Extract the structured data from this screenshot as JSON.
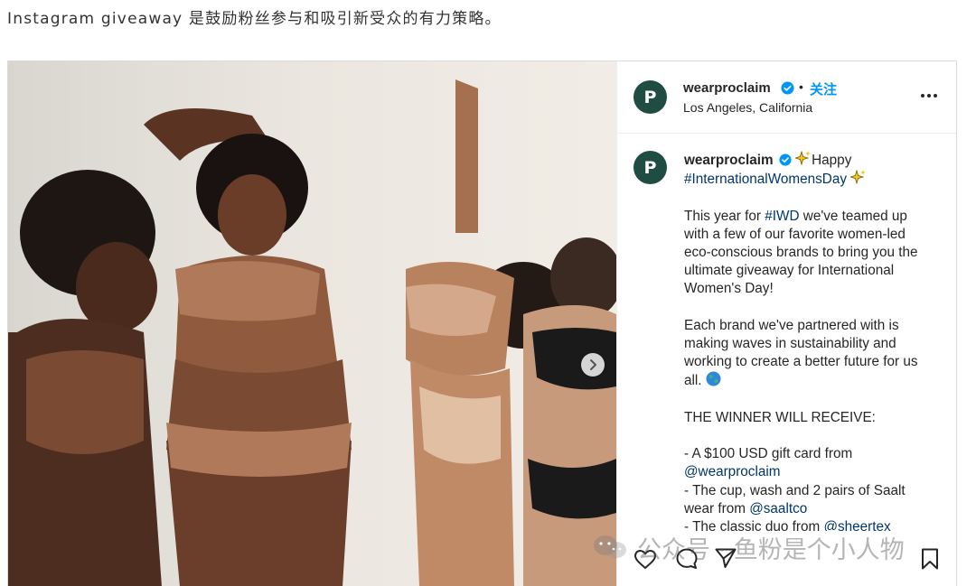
{
  "article": {
    "intro": "Instagram giveaway 是鼓励粉丝参与和吸引新受众的有力策略。"
  },
  "post": {
    "username": "wearproclaim",
    "avatar_letter": "P",
    "follow_label": "关注",
    "separator": "•",
    "location": "Los Angeles, California",
    "caption": {
      "username": "wearproclaim",
      "happy": "Happy",
      "hashtag_iwd_long": "#InternationalWomensDay",
      "p2_lead": "This year for ",
      "hashtag_iwd": "#IWD",
      "p2_rest": " we've teamed up with a few of our favorite women-led eco-conscious brands to bring you the ultimate giveaway for International Women's Day!",
      "p3": "Each brand we've partnered with is making waves in sustainability and working to create a better future for us all.",
      "p4": "THE WINNER WILL RECEIVE:",
      "item1_text": "- A $100 USD gift card from ",
      "item1_mention": "@wearproclaim",
      "item2_text": "- The cup, wash and 2 pairs of Saalt wear from ",
      "item2_mention": "@saaltco",
      "item3_text": "- The classic duo from ",
      "item3_mention": "@sheertex"
    },
    "icons": {
      "verified": "verified-badge-icon",
      "more": "more-options-icon",
      "like": "heart-icon",
      "comment": "comment-icon",
      "share": "paper-plane-icon",
      "save": "bookmark-icon",
      "next": "chevron-right-icon",
      "sparkle": "sparkles-emoji-icon",
      "globe": "globe-emoji-icon"
    },
    "colors": {
      "follow": "#0095f6",
      "verified": "#0095f6",
      "avatar_bg": "#1f4d43",
      "link": "#00376b"
    }
  },
  "watermark": {
    "text": "公众号 · 鱼粉是个小人物"
  }
}
